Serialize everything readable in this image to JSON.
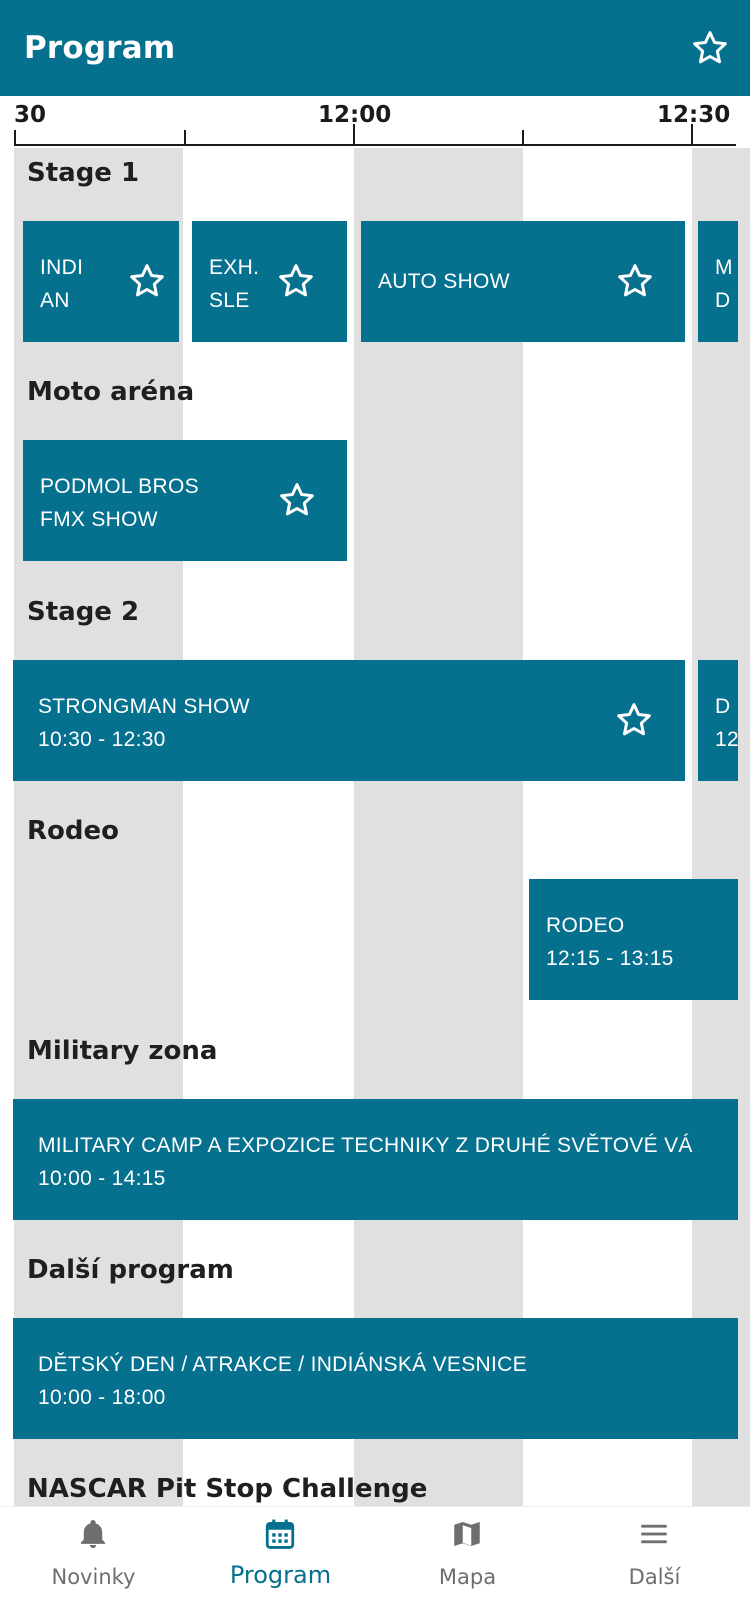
{
  "appbar": {
    "title": "Program",
    "favorite_icon": "star-outline-icon"
  },
  "colors": {
    "primary": "#05718f",
    "stripe": "#e0e0e0",
    "text": "#1f1f1f",
    "nav_inactive": "#6e6e6e"
  },
  "axis": {
    "labels": [
      "30",
      "12:00",
      "12:30"
    ]
  },
  "sections": [
    {
      "name": "Stage 1"
    },
    {
      "name": "Moto aréna"
    },
    {
      "name": "Stage 2"
    },
    {
      "name": "Rodeo"
    },
    {
      "name": "Military zona"
    },
    {
      "name": "Další program"
    },
    {
      "name": "NASCAR Pit Stop Challenge"
    }
  ],
  "events": {
    "indian": {
      "line1": "INDI",
      "line2": "AN"
    },
    "exhibition": {
      "line1": "EXH.",
      "line2": "SLE"
    },
    "auto_show": {
      "line1": "AUTO SHOW"
    },
    "stage1_next": {
      "line1": "M",
      "line2": "D"
    },
    "podmol": {
      "line1": "PODMOL BROS",
      "line2": "FMX SHOW"
    },
    "strongman": {
      "line1": "STRONGMAN SHOW",
      "line2": "10:30 - 12:30"
    },
    "stage2_next": {
      "line1": "D",
      "line2": "12"
    },
    "rodeo": {
      "line1": "RODEO",
      "line2": "12:15 - 13:15"
    },
    "military": {
      "line1": "MILITARY CAMP A EXPOZICE TECHNIKY Z DRUHÉ SVĚTOVÉ VÁ",
      "line2": "10:00 - 14:15"
    },
    "detsky_den": {
      "line1": "DĚTSKÝ DEN / ATRAKCE / INDIÁNSKÁ VESNICE",
      "line2": "10:00 - 18:00"
    }
  },
  "bottom_nav": [
    {
      "label": "Novinky",
      "icon": "bell-icon",
      "active": false
    },
    {
      "label": "Program",
      "icon": "calendar-icon",
      "active": true
    },
    {
      "label": "Mapa",
      "icon": "map-icon",
      "active": false
    },
    {
      "label": "Další",
      "icon": "menu-icon",
      "active": false
    }
  ]
}
